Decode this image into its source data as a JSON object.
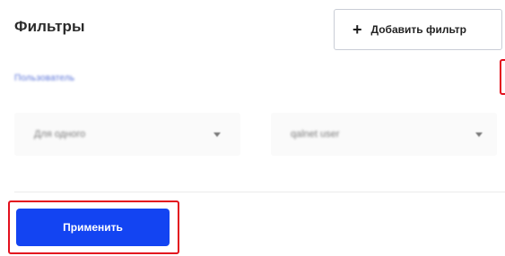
{
  "header": {
    "title": "Фильтры",
    "add_filter": {
      "icon": "plus-icon",
      "icon_glyph": "+",
      "label": "Добавить фильтр"
    }
  },
  "filter": {
    "label": "Пользователь",
    "remove_icon": "close-icon",
    "remove_glyph": "✕",
    "condition_select": {
      "value": "Для одного",
      "icon": "chevron-down-icon"
    },
    "value_select": {
      "value": "qalnet user",
      "icon": "chevron-down-icon"
    }
  },
  "footer": {
    "apply_label": "Применить"
  },
  "colors": {
    "primary": "#1344f2",
    "highlight": "#e3101e",
    "link": "#5872d8",
    "close": "#1d4ed8"
  }
}
